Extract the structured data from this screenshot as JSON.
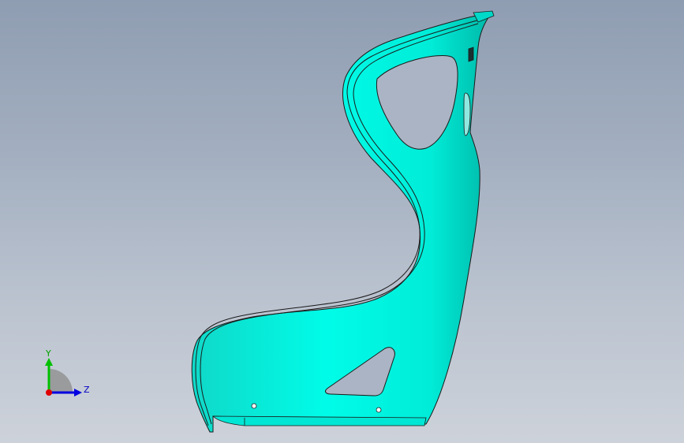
{
  "viewport": {
    "background_top": "#8f9db2",
    "background_bottom": "#cdd2da"
  },
  "model": {
    "part_name": "seat-shell",
    "fill_color": "#00f5e0",
    "edge_color": "#1a1a1a"
  },
  "triad": {
    "y_label": "Y",
    "z_label": "Z",
    "y_color": "#00c000",
    "z_color": "#0000e0",
    "x_color": "#e00000"
  }
}
